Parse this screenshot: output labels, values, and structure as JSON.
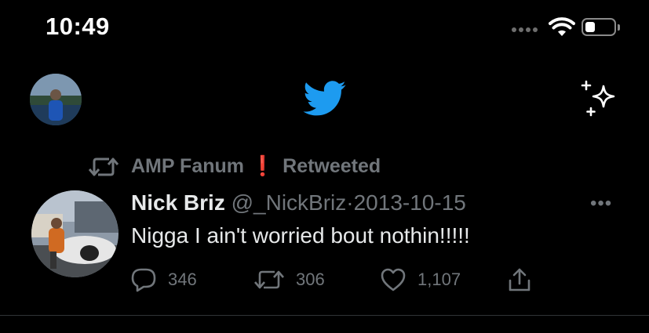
{
  "status_bar": {
    "time": "10:49"
  },
  "retweet": {
    "retweeter": "AMP Fanum",
    "badge": "❗",
    "label": "Retweeted"
  },
  "tweet": {
    "author_name": "Nick Briz",
    "handle": "@_NickBriz",
    "separator": "·",
    "date": "2013-10-15",
    "text": "Nigga I ain't worried bout nothin!!!!!",
    "more_label": "•••",
    "actions": {
      "replies": "346",
      "retweets": "306",
      "likes": "1,107"
    }
  },
  "colors": {
    "background": "#000000",
    "brand_blue": "#1d9bf0",
    "muted_text": "#71767b",
    "primary_text": "#e7e9ea"
  },
  "icons": [
    "wifi-icon",
    "battery-icon",
    "twitter-bird-icon",
    "sparkle-icon",
    "retweet-icon",
    "reply-icon",
    "like-icon",
    "share-icon",
    "more-icon"
  ]
}
